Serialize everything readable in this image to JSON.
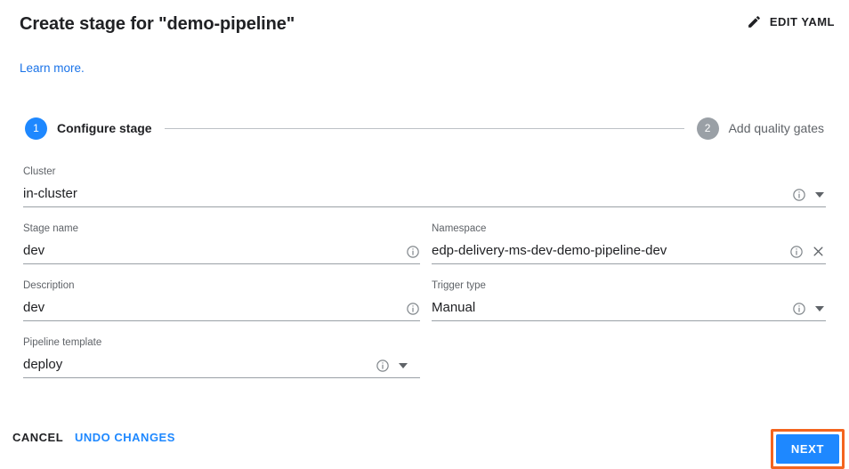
{
  "header": {
    "title": "Create stage for \"demo-pipeline\"",
    "edit_yaml_label": "EDIT YAML",
    "edit_yaml_icon": "pencil-icon"
  },
  "learn_more": {
    "label": "Learn more."
  },
  "stepper": {
    "steps": [
      {
        "number": "1",
        "label": "Configure stage",
        "state": "active"
      },
      {
        "number": "2",
        "label": "Add quality gates",
        "state": "inactive"
      }
    ]
  },
  "form": {
    "cluster": {
      "label": "Cluster",
      "value": "in-cluster",
      "info_icon": "info-icon",
      "dropdown_icon": "chevron-down-icon"
    },
    "stage_name": {
      "label": "Stage name",
      "value": "dev",
      "info_icon": "info-icon"
    },
    "namespace": {
      "label": "Namespace",
      "value": "edp-delivery-ms-dev-demo-pipeline-dev",
      "info_icon": "info-icon",
      "clear_icon": "close-icon"
    },
    "description": {
      "label": "Description",
      "value": "dev",
      "info_icon": "info-icon"
    },
    "trigger_type": {
      "label": "Trigger type",
      "value": "Manual",
      "info_icon": "info-icon",
      "dropdown_icon": "chevron-down-icon"
    },
    "pipeline_template": {
      "label": "Pipeline template",
      "value": "deploy",
      "info_icon": "info-icon",
      "dropdown_icon": "chevron-down-icon"
    }
  },
  "footer": {
    "cancel_label": "CANCEL",
    "undo_label": "UNDO CHANGES",
    "next_label": "NEXT"
  },
  "colors": {
    "accent_blue": "#1e88ff",
    "link_blue": "#1a73e8",
    "focus_orange": "#f4641e",
    "inactive_grey": "#9aa0a6",
    "text_primary": "#202124",
    "text_secondary": "#5f6368"
  }
}
